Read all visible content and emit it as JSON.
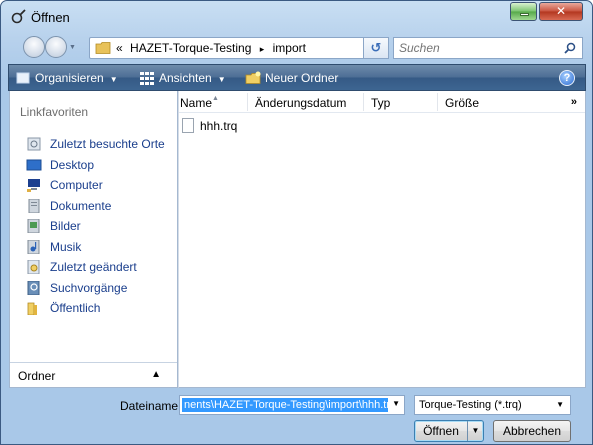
{
  "window": {
    "title": "Öffnen"
  },
  "address": {
    "prefix": "«",
    "path_folder": "HAZET-Torque-Testing",
    "separator": "▸",
    "path_sub": "import"
  },
  "search": {
    "placeholder": "Suchen"
  },
  "toolbar": {
    "organize": "Organisieren",
    "views": "Ansichten",
    "new_folder": "Neuer Ordner",
    "help": "?"
  },
  "sidebar": {
    "heading": "Linkfavoriten",
    "items": [
      {
        "label": "Zuletzt besuchte Orte",
        "icon": "recent-places-icon"
      },
      {
        "label": "Desktop",
        "icon": "desktop-icon"
      },
      {
        "label": "Computer",
        "icon": "computer-icon"
      },
      {
        "label": "Dokumente",
        "icon": "documents-icon"
      },
      {
        "label": "Bilder",
        "icon": "pictures-icon"
      },
      {
        "label": "Musik",
        "icon": "music-icon"
      },
      {
        "label": "Zuletzt geändert",
        "icon": "recently-changed-icon"
      },
      {
        "label": "Suchvorgänge",
        "icon": "searches-icon"
      },
      {
        "label": "Öffentlich",
        "icon": "public-folder-icon"
      }
    ],
    "folders_label": "Ordner"
  },
  "file_list": {
    "columns": [
      "Name",
      "Änderungsdatum",
      "Typ",
      "Größe"
    ],
    "more": "»",
    "files": [
      {
        "name": "hhh.trq"
      }
    ]
  },
  "bottom": {
    "filename_label": "Dateiname:",
    "filename_value": "nents\\HAZET-Torque-Testing\\import\\hhh.trq",
    "filetype": "Torque-Testing (*.trq)",
    "open_label": "Öffnen",
    "cancel_label": "Abbrechen"
  },
  "colors": {
    "toolbar": "#4d6e95",
    "link": "#1a3e8c",
    "selection": "#3399ff"
  }
}
